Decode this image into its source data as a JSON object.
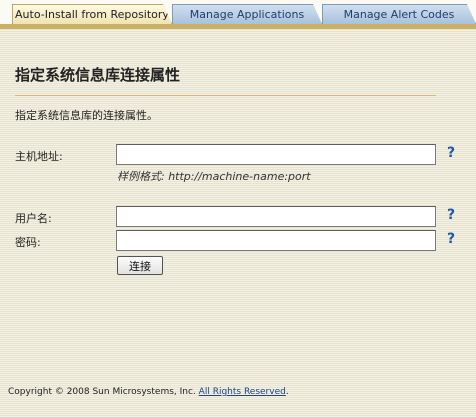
{
  "tabs": [
    {
      "label": "Auto-Install from Repository",
      "active": true
    },
    {
      "label": "Manage Applications",
      "active": false
    },
    {
      "label": "Manage Alert Codes",
      "active": false
    }
  ],
  "page": {
    "title": "指定系统信息库连接属性",
    "description": "指定系统信息库的连接属性。"
  },
  "form": {
    "host": {
      "label": "主机地址:",
      "value": "",
      "hint": "样例格式:  http://machine-name:port"
    },
    "username": {
      "label": "用户名:",
      "value": ""
    },
    "password": {
      "label": "密码:",
      "value": ""
    },
    "help_symbol": "?",
    "connect_label": "连接"
  },
  "footer": {
    "copyright_prefix": "Copyright © 2008 Sun Microsystems, Inc.",
    "rights_link": "All Rights Reserved",
    "copyright_suffix": "."
  },
  "colors": {
    "accent_tab_line": "#c9b064",
    "help_icon": "#1f5aa6",
    "tab_inactive": "#a9c1dc"
  }
}
